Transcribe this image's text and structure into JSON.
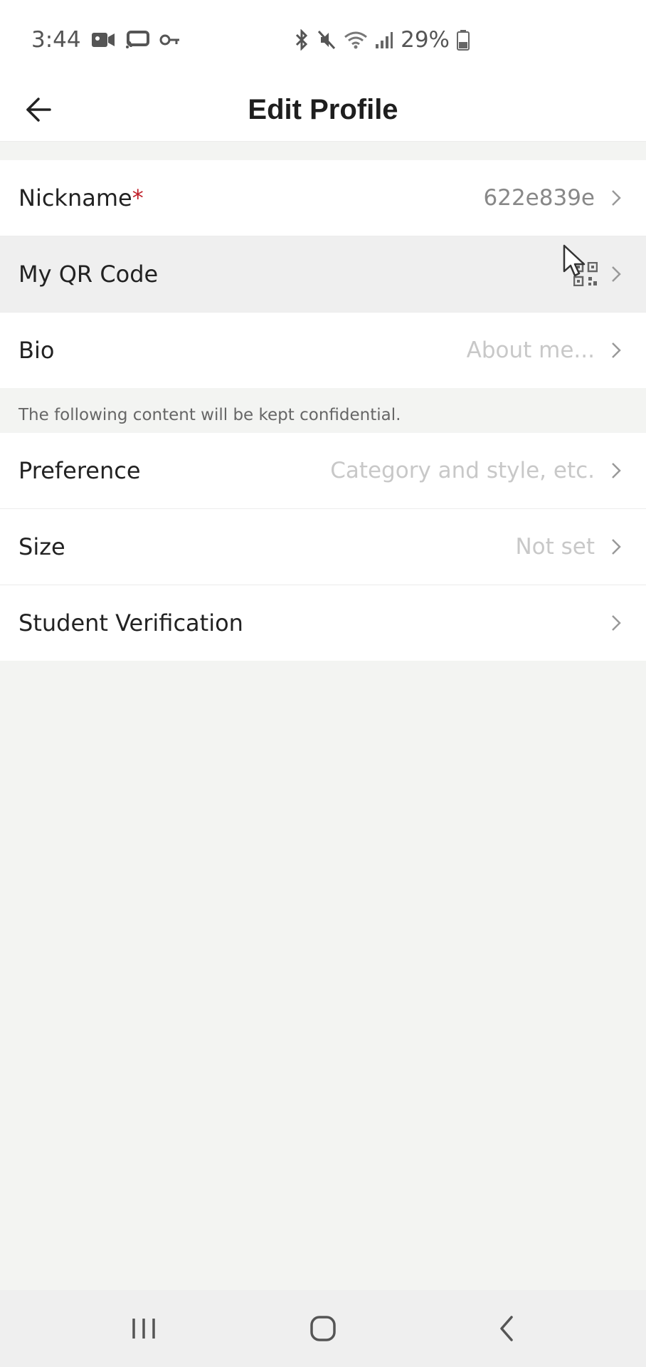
{
  "status_bar": {
    "time": "3:44",
    "battery": "29%",
    "left_icons": [
      "video-camera-icon",
      "cast-icon",
      "key-icon"
    ],
    "right_icons": [
      "bluetooth-icon",
      "mute-icon",
      "wifi-icon",
      "signal-icon",
      "battery-icon"
    ]
  },
  "header": {
    "title": "Edit Profile",
    "back_icon": "arrow-left-icon"
  },
  "profile_rows": [
    {
      "label": "Nickname",
      "required_mark": "*",
      "value": "622e839e"
    },
    {
      "label": "My QR Code",
      "icon": "qr-code-icon"
    },
    {
      "label": "Bio",
      "placeholder": "About me..."
    }
  ],
  "confidential_note": "The following content will be kept confidential.",
  "private_rows": [
    {
      "label": "Preference",
      "placeholder": "Category and style, etc."
    },
    {
      "label": "Size",
      "placeholder": "Not set"
    },
    {
      "label": "Student Verification"
    }
  ],
  "nav": {
    "recents_icon": "recents-icon",
    "home_icon": "home-icon",
    "back_icon": "back-icon"
  },
  "colors": {
    "background": "#f3f4f2",
    "surface": "#ffffff",
    "required": "#c0202a",
    "placeholder": "#c8c8c8"
  }
}
